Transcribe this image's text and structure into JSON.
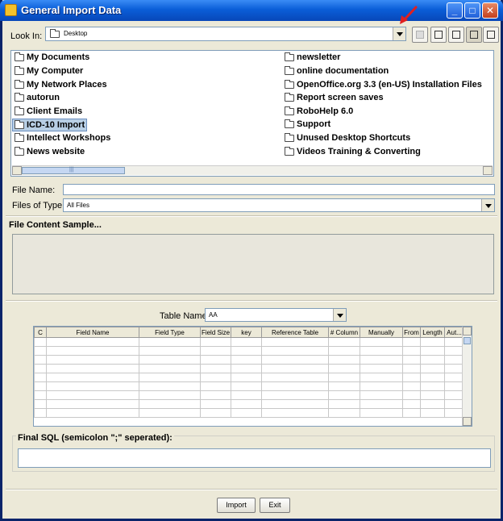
{
  "window": {
    "title": "General Import Data",
    "buttons": {
      "minimize": "_",
      "maximize": "□",
      "close": "✕"
    }
  },
  "file_chooser": {
    "look_in_label": "Look In:",
    "look_in_value": "Desktop",
    "file_name_label": "File Name:",
    "file_name_value": "",
    "files_of_type_label": "Files of Type:",
    "files_of_type_value": "All Files",
    "files_left": [
      "My Documents",
      "My Computer",
      "My Network Places",
      "autorun",
      "Client Emails",
      "ICD-10 Import",
      "Intellect Workshops",
      "News website"
    ],
    "files_right": [
      "newsletter",
      "online documentation",
      "OpenOffice.org 3.3 (en-US) Installation Files",
      "Report screen saves",
      "RoboHelp 6.0",
      "Support",
      "Unused Desktop Shortcuts",
      "Videos Training & Converting"
    ],
    "selected_item": "ICD-10 Import",
    "scroll_thumb_glyph": "|||"
  },
  "sample": {
    "title": "File Content Sample..."
  },
  "mapping": {
    "table_name_label": "Table Name",
    "table_name_value": "AA",
    "columns": [
      "C",
      "Field Name",
      "Field Type",
      "Field Size",
      "key",
      "Reference Table",
      "# Column",
      "Manually",
      "From",
      "Length",
      "Aut..."
    ]
  },
  "final_sql": {
    "title": "Final SQL (semicolon \";\" seperated):",
    "value": ""
  },
  "footer": {
    "import_label": "Import",
    "exit_label": "Exit"
  },
  "colors": {
    "accent": "#0a5ed8",
    "annotation_arrow": "#e02020",
    "selection": "#b8cfe5"
  }
}
